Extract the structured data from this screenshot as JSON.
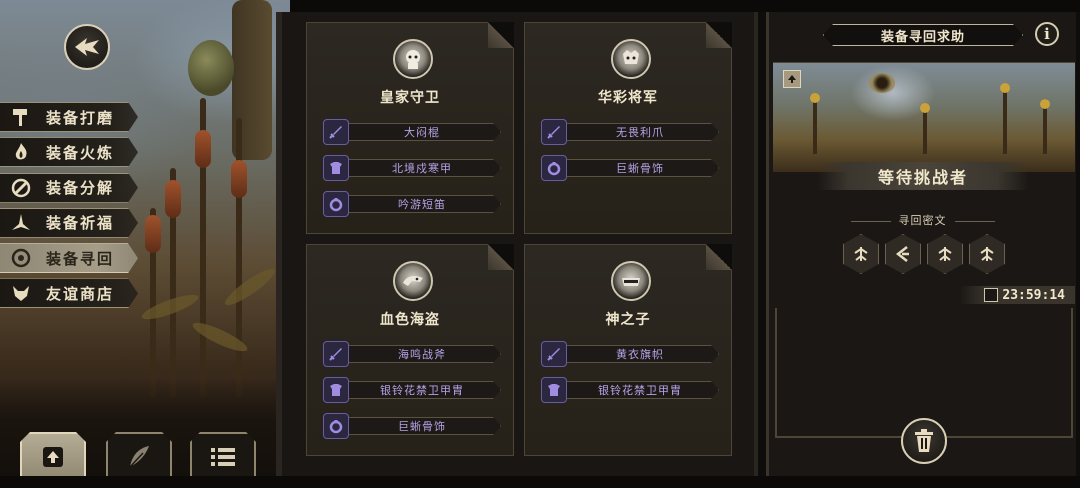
{
  "menu": {
    "items": [
      {
        "label": "装备打磨",
        "icon": "hammer-icon",
        "active": false
      },
      {
        "label": "装备火炼",
        "icon": "flame-icon",
        "active": false
      },
      {
        "label": "装备分解",
        "icon": "disassemble-icon",
        "active": false
      },
      {
        "label": "装备祈福",
        "icon": "blessing-icon",
        "active": false
      },
      {
        "label": "装备寻回",
        "icon": "target-icon",
        "active": true
      },
      {
        "label": "友谊商店",
        "icon": "fox-icon",
        "active": false
      }
    ]
  },
  "bottom_tabs": [
    {
      "icon": "upload-icon",
      "active": true
    },
    {
      "icon": "feather-icon",
      "active": false
    },
    {
      "icon": "list-icon",
      "active": false
    }
  ],
  "cards": [
    {
      "name": "皇家守卫",
      "items": [
        {
          "label": "大闷棍",
          "icon": "sword-icon"
        },
        {
          "label": "北境戍寒甲",
          "icon": "armor-icon"
        },
        {
          "label": "吟游短笛",
          "icon": "ring-icon"
        }
      ]
    },
    {
      "name": "华彩将军",
      "items": [
        {
          "label": "无畏利爪",
          "icon": "sword-icon"
        },
        {
          "label": "巨蜥骨饰",
          "icon": "ring-icon"
        }
      ]
    },
    {
      "name": "血色海盗",
      "items": [
        {
          "label": "海鸣战斧",
          "icon": "sword-icon"
        },
        {
          "label": "银铃花禁卫甲胄",
          "icon": "armor-icon"
        },
        {
          "label": "巨蜥骨饰",
          "icon": "ring-icon"
        }
      ]
    },
    {
      "name": "神之子",
      "items": [
        {
          "label": "黄衣旗帜",
          "icon": "sword-icon"
        },
        {
          "label": "银铃花禁卫甲胄",
          "icon": "armor-icon"
        }
      ]
    }
  ],
  "right_panel": {
    "title": "装备寻回求助",
    "status": "等待挑战者",
    "cipher_label": "寻回密文",
    "glyphs": [
      "rune-1-icon",
      "rune-2-icon",
      "rune-1-icon",
      "rune-1-icon"
    ],
    "timer": "23:59:14"
  },
  "colors": {
    "accent_purple": "#b7a4e8",
    "gold_text": "#efe5ca",
    "panel_bg": "#191613"
  }
}
